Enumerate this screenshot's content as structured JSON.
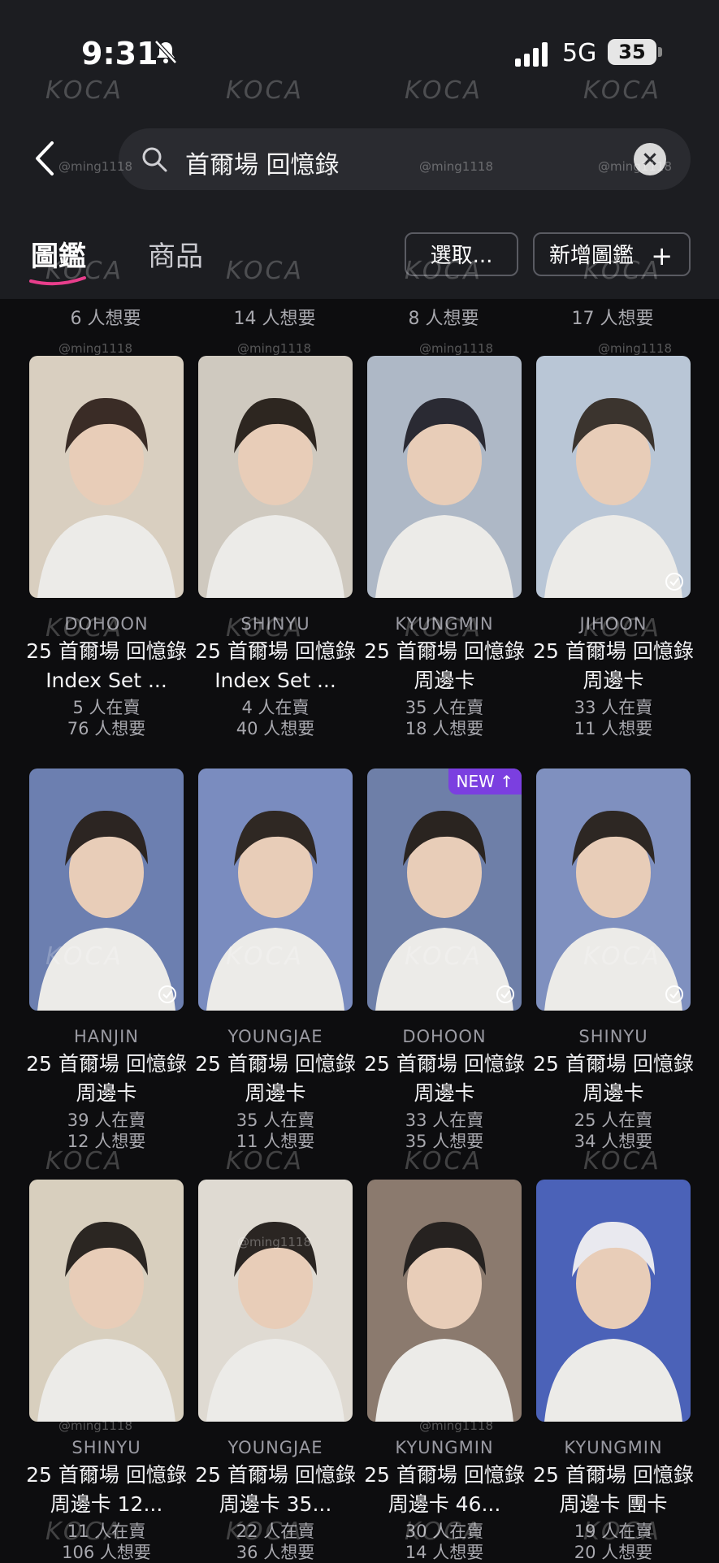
{
  "status_bar": {
    "time": "9:31",
    "network": "5G",
    "battery": "35"
  },
  "search": {
    "query": "首爾場 回憶錄"
  },
  "tabs": [
    {
      "label": "圖鑑"
    },
    {
      "label": "商品"
    }
  ],
  "buttons": {
    "select": "選取...",
    "add": "新增圖鑑",
    "add_icon": "+"
  },
  "watermarks": {
    "brand": "KOCA",
    "handle": "@ming1118"
  },
  "peek_row": [
    {
      "want": "6 人想要"
    },
    {
      "want": "14 人想要"
    },
    {
      "want": "8 人想要"
    },
    {
      "want": "17 人想要"
    }
  ],
  "cards": [
    {
      "member": "DOHOON",
      "title": "25 首爾場 回憶錄 Index Set ...",
      "sell": "5 人在賣",
      "want": "76 人想要",
      "checked": false,
      "new": false
    },
    {
      "member": "SHINYU",
      "title": "25 首爾場 回憶錄 Index Set ...",
      "sell": "4 人在賣",
      "want": "40 人想要",
      "checked": false,
      "new": false
    },
    {
      "member": "KYUNGMIN",
      "title": "25 首爾場 回憶錄 周邊卡",
      "sell": "35 人在賣",
      "want": "18 人想要",
      "checked": false,
      "new": false
    },
    {
      "member": "JIHOON",
      "title": "25 首爾場 回憶錄 周邊卡",
      "sell": "33 人在賣",
      "want": "11 人想要",
      "checked": true,
      "new": false
    },
    {
      "member": "HANJIN",
      "title": "25 首爾場 回憶錄 周邊卡",
      "sell": "39 人在賣",
      "want": "12 人想要",
      "checked": true,
      "new": false
    },
    {
      "member": "YOUNGJAE",
      "title": "25 首爾場 回憶錄 周邊卡",
      "sell": "35 人在賣",
      "want": "11 人想要",
      "checked": false,
      "new": false
    },
    {
      "member": "DOHOON",
      "title": "25 首爾場 回憶錄 周邊卡",
      "sell": "33 人在賣",
      "want": "35 人想要",
      "checked": true,
      "new": true,
      "badge": "NEW ↑"
    },
    {
      "member": "SHINYU",
      "title": "25 首爾場 回憶錄 周邊卡",
      "sell": "25 人在賣",
      "want": "34 人想要",
      "checked": true,
      "new": false
    },
    {
      "member": "SHINYU",
      "title": "25 首爾場 回憶錄 周邊卡 12...",
      "sell": "11 人在賣",
      "want": "106 人想要",
      "checked": false,
      "new": false
    },
    {
      "member": "YOUNGJAE",
      "title": "25 首爾場 回憶錄 周邊卡 35...",
      "sell": "22 人在賣",
      "want": "36 人想要",
      "checked": false,
      "new": false
    },
    {
      "member": "KYUNGMIN",
      "title": "25 首爾場 回憶錄 周邊卡 46...",
      "sell": "30 人在賣",
      "want": "14 人想要",
      "checked": false,
      "new": false
    },
    {
      "member": "KYUNGMIN",
      "title": "25 首爾場 回憶錄 周邊卡 團卡",
      "sell": "19 人在賣",
      "want": "20 人想要",
      "checked": false,
      "new": false
    }
  ],
  "colors": {
    "accent": "#e83e8c",
    "new_badge": "#7b3fe0",
    "header_bg": "#1c1d21",
    "page_bg": "#0d0d0f"
  }
}
